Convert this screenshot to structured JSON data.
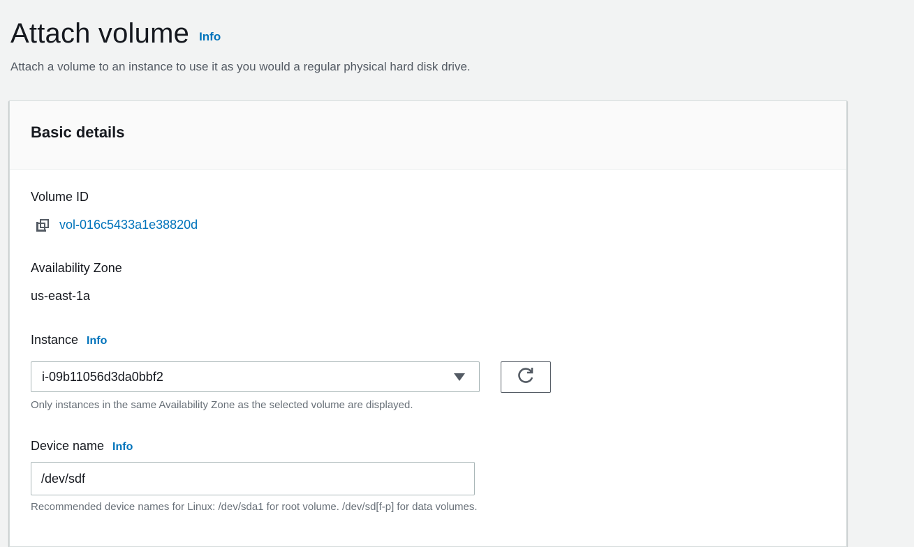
{
  "page": {
    "title": "Attach volume",
    "title_info": "Info",
    "description": "Attach a volume to an instance to use it as you would a regular physical hard disk drive."
  },
  "panel": {
    "title": "Basic details",
    "volume_id": {
      "label": "Volume ID",
      "value": "vol-016c5433a1e38820d",
      "copy_icon": "copy-icon"
    },
    "availability_zone": {
      "label": "Availability Zone",
      "value": "us-east-1a"
    },
    "instance": {
      "label": "Instance",
      "info": "Info",
      "selected": "i-09b11056d3da0bbf2",
      "hint": "Only instances in the same Availability Zone as the selected volume are displayed.",
      "refresh_icon": "refresh-icon",
      "caret_icon": "caret-down-icon"
    },
    "device_name": {
      "label": "Device name",
      "info": "Info",
      "value": "/dev/sdf",
      "hint": "Recommended device names for Linux: /dev/sda1 for root volume. /dev/sd[f-p] for data volumes."
    }
  },
  "colors": {
    "link": "#0073bb",
    "text": "#16191f",
    "secondary_text": "#545b64",
    "hint_text": "#687078",
    "background": "#f2f3f3"
  }
}
